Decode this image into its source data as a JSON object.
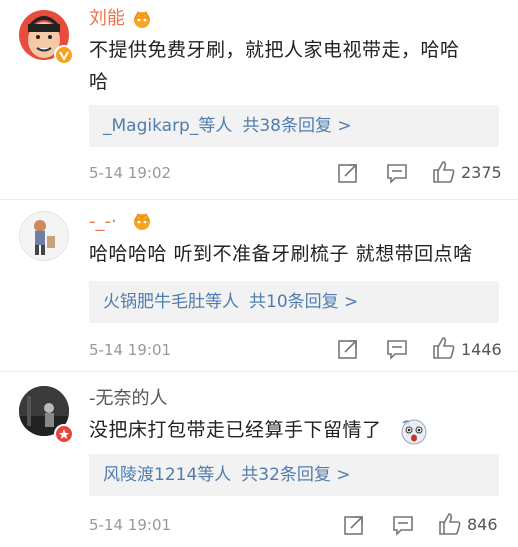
{
  "comments": [
    {
      "username": "刘能",
      "text_line1": "不提供免费牙刷，就把人家电视带走，哈哈",
      "text_line2": "哈",
      "replies_users": "_Magikarp_",
      "replies_mid": "等人",
      "replies_count": "共38条回复 >",
      "time": "5-14 19:02",
      "likes": "2375"
    },
    {
      "username": "-_-·",
      "text_line1": "哈哈哈哈  听到不准备牙刷梳子  就想带回点啥",
      "replies_users": "火锅肥牛毛肚",
      "replies_mid": "等人",
      "replies_count": "共10条回复 >",
      "time": "5-14 19:01",
      "likes": "1446"
    },
    {
      "username": "-无奈的人",
      "text_line1": "没把床打包带走已经算手下留情了",
      "replies_users": "风陵渡1214",
      "replies_mid": "等人",
      "replies_count": "共32条回复 >",
      "time": "5-14 19:01",
      "likes": "846"
    }
  ],
  "colors": {
    "name_orange": "#eb7350",
    "link_blue": "#507daf",
    "reply_bg": "#f2f2f2",
    "meta_gray": "#999999"
  },
  "icons": {
    "vip": "crown-vip-icon",
    "forward": "forward-icon",
    "comment": "comment-icon",
    "like": "thumbs-up-icon",
    "verified": "verified-badge-icon",
    "emoji": "surprised-emoji-icon"
  }
}
